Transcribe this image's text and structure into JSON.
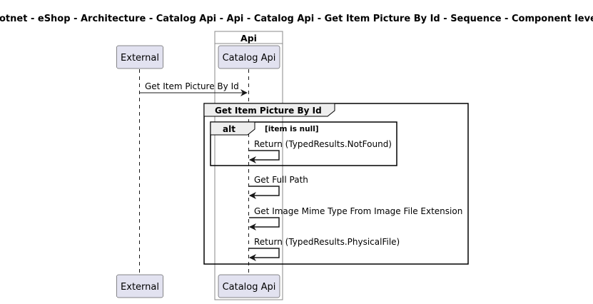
{
  "title": "dotnet - eShop - Architecture - Catalog Api - Api - Catalog Api - Get Item Picture By Id - Sequence - Component level",
  "box": {
    "label": "Api"
  },
  "participants": [
    {
      "id": "external",
      "label": "External"
    },
    {
      "id": "catalog-api",
      "label": "Catalog Api"
    }
  ],
  "messages": [
    {
      "from": "external",
      "to": "catalog-api",
      "label": "Get Item Picture By Id"
    },
    {
      "from": "catalog-api",
      "to": "catalog-api",
      "label": "Return (TypedResults.NotFound)"
    },
    {
      "from": "catalog-api",
      "to": "catalog-api",
      "label": "Get Full Path"
    },
    {
      "from": "catalog-api",
      "to": "catalog-api",
      "label": "Get Image Mime Type From Image File Extension"
    },
    {
      "from": "catalog-api",
      "to": "catalog-api",
      "label": "Return (TypedResults.PhysicalFile)"
    }
  ],
  "groups": [
    {
      "type": "group",
      "label": "Get Item Picture By Id"
    },
    {
      "type": "alt",
      "label": "alt",
      "guard": "[item is null]"
    }
  ],
  "colors": {
    "participant_fill": "#E2E2F0",
    "participant_border": "#181818",
    "box_border": "#888888",
    "frame_header_fill": "#EEEEEE",
    "lifeline": "#181818",
    "text": "#000000"
  }
}
